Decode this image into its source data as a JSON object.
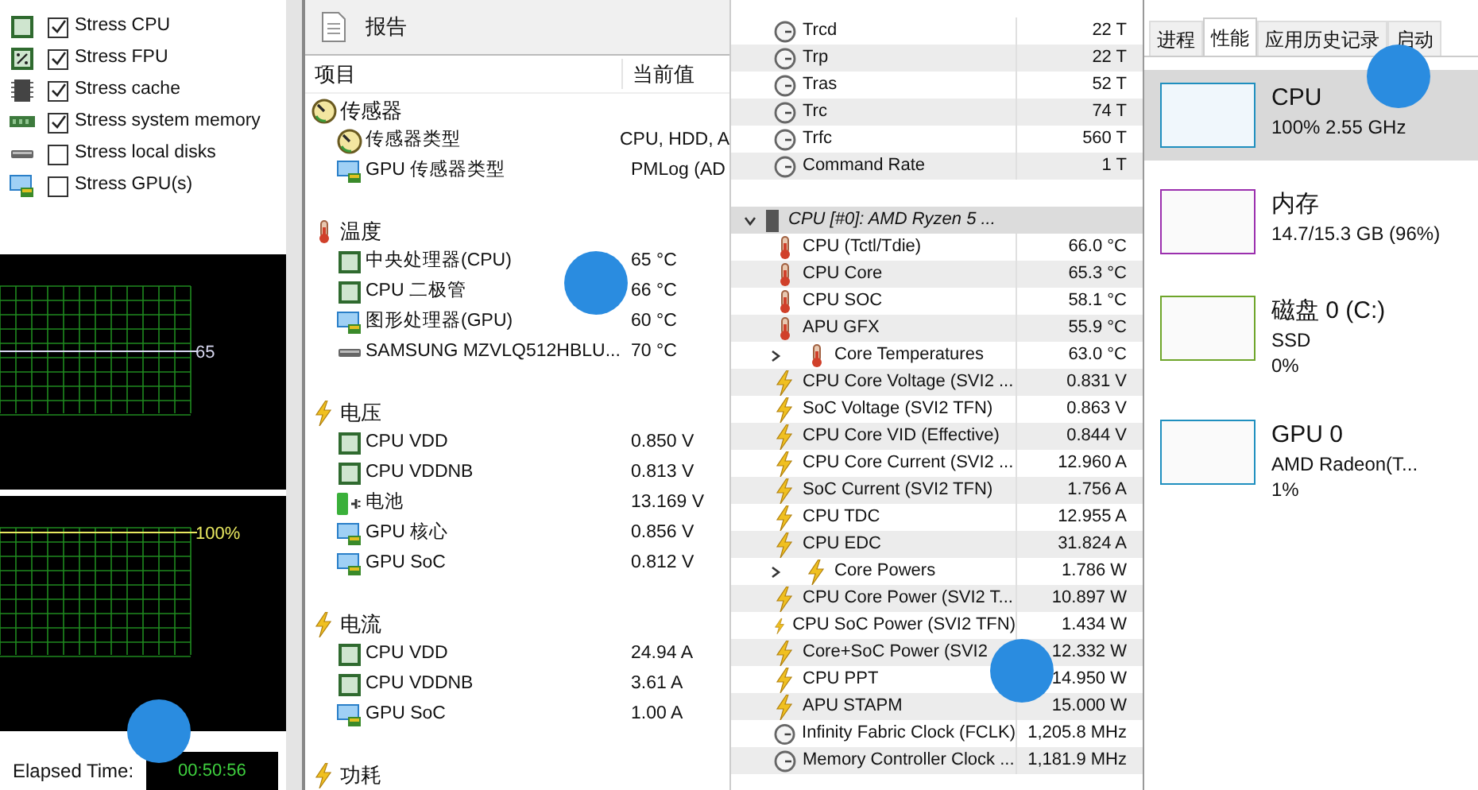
{
  "stress": {
    "options": [
      {
        "label": "Stress CPU",
        "kind": "cpu",
        "checked": true
      },
      {
        "label": "Stress FPU",
        "kind": "fpu",
        "checked": true
      },
      {
        "label": "Stress cache",
        "kind": "cache",
        "checked": true
      },
      {
        "label": "Stress system memory",
        "kind": "memory",
        "checked": true
      },
      {
        "label": "Stress local disks",
        "kind": "disk",
        "checked": false
      },
      {
        "label": "Stress GPU(s)",
        "kind": "gpu",
        "checked": false
      }
    ],
    "graphs": [
      {
        "reading": "65",
        "color": "#d8d8f0"
      },
      {
        "reading": "100%",
        "color": "#e8e860"
      }
    ],
    "elapsed_label": "Elapsed Time:",
    "elapsed_value": "00:50:56"
  },
  "report": {
    "title": "报告",
    "columns": [
      "项目",
      "当前值"
    ],
    "groups": [
      {
        "label": "传感器",
        "kind": "sensor",
        "items": [
          {
            "label": "传感器类型",
            "kind": "sensor",
            "value": "CPU, HDD, A"
          },
          {
            "label": "GPU 传感器类型",
            "kind": "gpu",
            "value": "PMLog  (AD"
          }
        ]
      },
      {
        "label": "温度",
        "kind": "thermo",
        "items": [
          {
            "label": "中央处理器(CPU)",
            "kind": "chip",
            "value": "65 °C"
          },
          {
            "label": "CPU 二极管",
            "kind": "chip",
            "value": "66 °C"
          },
          {
            "label": "图形处理器(GPU)",
            "kind": "gpu",
            "value": "60 °C"
          },
          {
            "label": "SAMSUNG MZVLQ512HBLU...",
            "kind": "disk",
            "value": "70 °C"
          }
        ]
      },
      {
        "label": "电压",
        "kind": "bolt",
        "items": [
          {
            "label": "CPU VDD",
            "kind": "chip",
            "value": "0.850 V"
          },
          {
            "label": "CPU VDDNB",
            "kind": "chip",
            "value": "0.813 V"
          },
          {
            "label": "电池",
            "kind": "battery",
            "value": "13.169 V"
          },
          {
            "label": "GPU 核心",
            "kind": "gpu",
            "value": "0.856 V"
          },
          {
            "label": "GPU SoC",
            "kind": "gpu",
            "value": "0.812 V"
          }
        ]
      },
      {
        "label": "电流",
        "kind": "bolt",
        "items": [
          {
            "label": "CPU VDD",
            "kind": "chip",
            "value": "24.94 A"
          },
          {
            "label": "CPU VDDNB",
            "kind": "chip",
            "value": "3.61 A"
          },
          {
            "label": "GPU SoC",
            "kind": "gpu",
            "value": "1.00 A"
          }
        ]
      },
      {
        "label": "功耗",
        "kind": "bolt"
      }
    ]
  },
  "sensors": {
    "rows": [
      {
        "kind": "clock",
        "label": "Trcd",
        "value": "22 T"
      },
      {
        "kind": "clock",
        "label": "Trp",
        "value": "22 T"
      },
      {
        "kind": "clock",
        "label": "Tras",
        "value": "52 T"
      },
      {
        "kind": "clock",
        "label": "Trc",
        "value": "74 T"
      },
      {
        "kind": "clock",
        "label": "Trfc",
        "value": "560 T"
      },
      {
        "kind": "clock",
        "label": "Command Rate",
        "value": "1 T"
      },
      {
        "kind": "blank"
      },
      {
        "kind": "device",
        "label": "CPU [#0]: AMD Ryzen 5 ...",
        "expanded": true
      },
      {
        "kind": "thermo",
        "label": "CPU (Tctl/Tdie)",
        "value": "66.0 °C"
      },
      {
        "kind": "thermo",
        "label": "CPU Core",
        "value": "65.3 °C"
      },
      {
        "kind": "thermo",
        "label": "CPU SOC",
        "value": "58.1 °C"
      },
      {
        "kind": "thermo",
        "label": "APU GFX",
        "value": "55.9 °C"
      },
      {
        "kind": "thermo",
        "label": "Core Temperatures",
        "value": "63.0 °C",
        "expanded": false
      },
      {
        "kind": "bolt",
        "label": "CPU Core Voltage (SVI2 ...",
        "value": "0.831 V"
      },
      {
        "kind": "bolt",
        "label": "SoC Voltage (SVI2 TFN)",
        "value": "0.863 V"
      },
      {
        "kind": "bolt",
        "label": "CPU Core VID (Effective)",
        "value": "0.844 V"
      },
      {
        "kind": "bolt",
        "label": "CPU Core Current (SVI2 ...",
        "value": "12.960 A"
      },
      {
        "kind": "bolt",
        "label": "SoC Current (SVI2 TFN)",
        "value": "1.756 A"
      },
      {
        "kind": "bolt",
        "label": "CPU TDC",
        "value": "12.955 A"
      },
      {
        "kind": "bolt",
        "label": "CPU EDC",
        "value": "31.824 A"
      },
      {
        "kind": "bolt",
        "label": "Core Powers",
        "value": "1.786 W",
        "expanded": false
      },
      {
        "kind": "bolt",
        "label": "CPU Core Power (SVI2 T...",
        "value": "10.897 W"
      },
      {
        "kind": "bolt",
        "label": "CPU SoC Power (SVI2 TFN)",
        "value": "1.434 W"
      },
      {
        "kind": "bolt",
        "label": "Core+SoC Power (SVI2",
        "value": "12.332 W"
      },
      {
        "kind": "bolt",
        "label": "CPU PPT",
        "value": "14.950 W"
      },
      {
        "kind": "bolt",
        "label": "APU STAPM",
        "value": "15.000 W"
      },
      {
        "kind": "clock",
        "label": "Infinity Fabric Clock (FCLK)",
        "value": "1,205.8 MHz"
      },
      {
        "kind": "clock",
        "label": "Memory Controller Clock ...",
        "value": "1,181.9 MHz"
      }
    ]
  },
  "task_manager": {
    "tabs": [
      {
        "label": "进程",
        "selected": false
      },
      {
        "label": "性能",
        "selected": true
      },
      {
        "label": "应用历史记录",
        "selected": false
      },
      {
        "label": "启动",
        "selected": false
      }
    ],
    "resources": [
      {
        "name": "CPU",
        "lines": [
          "100% 2.55 GHz"
        ],
        "color": "#1f8fbf",
        "selected": true
      },
      {
        "name": "内存",
        "lines": [
          "14.7/15.3 GB (96%)"
        ],
        "color": "#9b2fae",
        "selected": false
      },
      {
        "name": "磁盘 0 (C:)",
        "lines": [
          "SSD",
          "0%"
        ],
        "color": "#6ea52a",
        "selected": false
      },
      {
        "name": "GPU 0",
        "lines": [
          "AMD Radeon(T...",
          "1%"
        ],
        "color": "#1f8fbf",
        "selected": false
      }
    ]
  }
}
